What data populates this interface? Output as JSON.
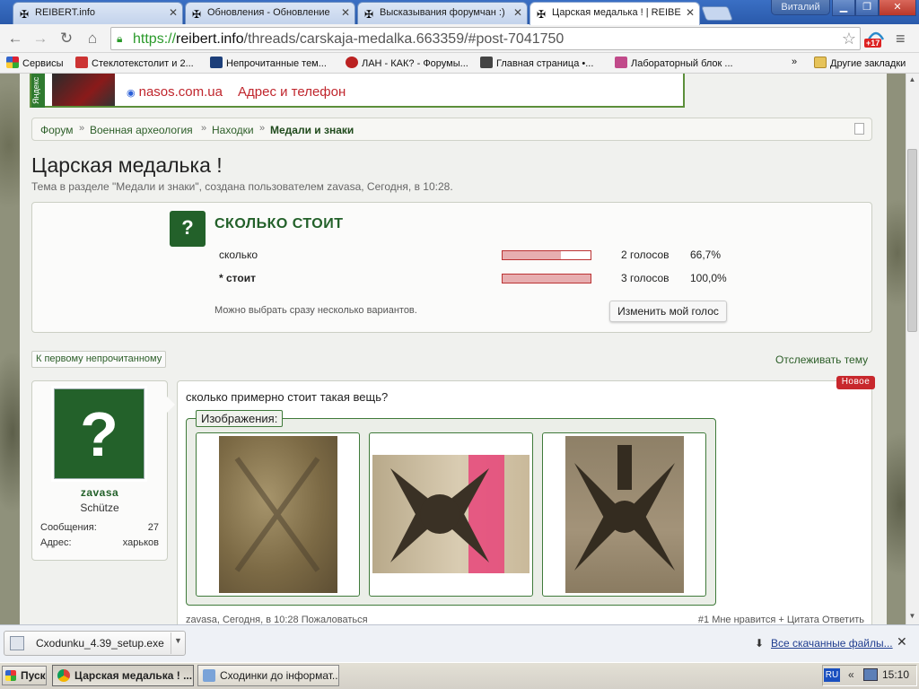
{
  "browser": {
    "tabs": [
      {
        "title": "REIBERT.info"
      },
      {
        "title": "Обновления - Обновление"
      },
      {
        "title": "Высказывания форумчан :)"
      },
      {
        "title": "Царская медалька ! | REIBE"
      }
    ],
    "user_badge": "Виталий",
    "url": {
      "scheme": "https://",
      "domain": "reibert.info",
      "path": "/threads/carskaja-medalka.663359/#post-7041750"
    },
    "ext_badge": "+17",
    "bookmarks": [
      {
        "label": "Сервисы",
        "color": "#d23"
      },
      {
        "label": "Стеклотекстолит и 2...",
        "color": "#c33"
      },
      {
        "label": "Непрочитанные тем...",
        "color": "#1d3f7a"
      },
      {
        "label": "ЛАН - КАК? - Форумы...",
        "color": "#b22"
      },
      {
        "label": "Главная страница •...",
        "color": "#444"
      },
      {
        "label": "Лабораторный блок ...",
        "color": "#c14a8a"
      }
    ],
    "bookmarks_more": "»",
    "other_bookmarks": "Другие закладки"
  },
  "ad": {
    "label": "Яндекс",
    "site": "nasos.com.ua",
    "link": "Адрес и телефон"
  },
  "breadcrumb": [
    "Форум",
    "Военная археология",
    "Находки",
    "Медали и знаки"
  ],
  "thread": {
    "title": "Царская медалька !",
    "subtitle": "Тема в разделе \"Медали и знаки\", создана пользователем zavasa, Сегодня, в 10:28."
  },
  "poll": {
    "question_icon": "?",
    "question": "СКОЛЬКО СТОИТ",
    "options": [
      {
        "label": "сколько",
        "votes": "2 голосов",
        "percent": "66,7%",
        "fill": 0.667,
        "selected": false
      },
      {
        "label": "* стоит",
        "votes": "3 голосов",
        "percent": "100,0%",
        "fill": 1.0,
        "selected": true
      }
    ],
    "note": "Можно выбрать сразу несколько вариантов.",
    "change_vote": "Изменить мой голос"
  },
  "links": {
    "first_unread": "К первому непрочитанному",
    "watch": "Отслеживать тему"
  },
  "user": {
    "avatar_glyph": "?",
    "name": "zavasa",
    "title": "Schütze",
    "messages_label": "Сообщения:",
    "messages": "27",
    "address_label": "Адрес:",
    "address": "харьков"
  },
  "post": {
    "badge": "Новое",
    "text": "сколько примерно стоит такая вещь?",
    "attachments_label": "Изображения:",
    "footer_left": "zavasa, Сегодня, в 10:28   Пожаловаться",
    "footer_right": "#1   Мне нравится   + Цитата   Ответить"
  },
  "downloads": {
    "file": "Cxodunku_4.39_setup.exe",
    "all": "Все скачанные файлы..."
  },
  "taskbar": {
    "start": "Пуск",
    "tasks": [
      "Царская медалька ! ...",
      "Сходинки до інформат..."
    ],
    "lang": "RU",
    "tray_arrows": "«",
    "clock": "15:10"
  },
  "colors": {
    "forum_green": "#23612a",
    "link_green": "#2c5e28",
    "poll_fill": "#e7aeb0",
    "new_badge": "#c8282d"
  }
}
